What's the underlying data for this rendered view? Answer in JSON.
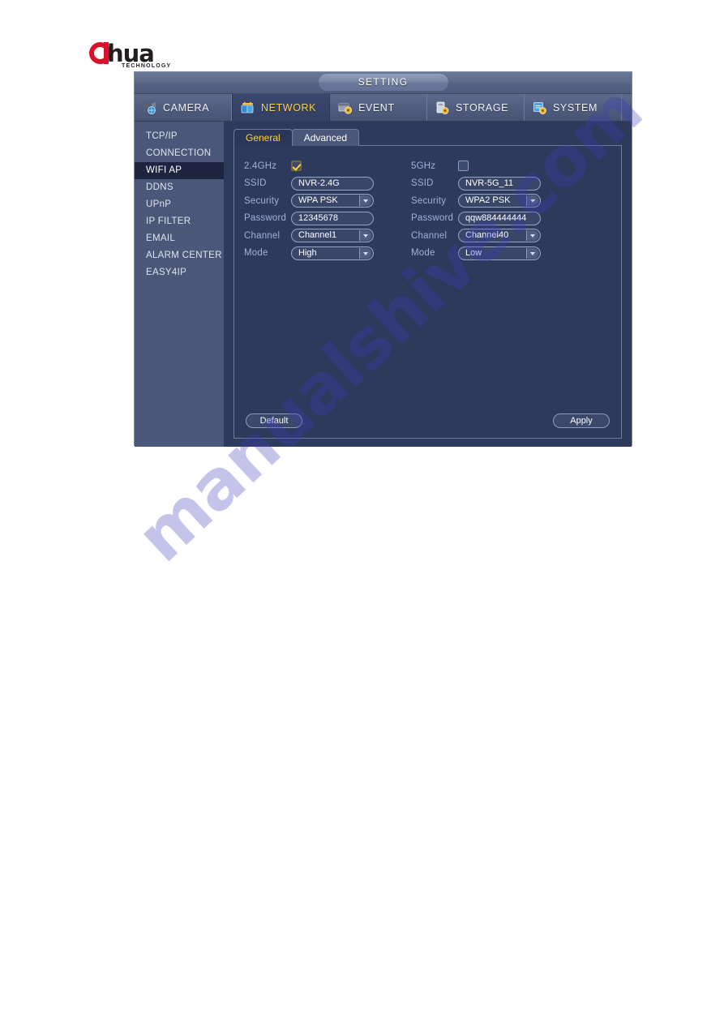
{
  "brand": {
    "name": "alhua",
    "wordmark": "hua",
    "tagline": "TECHNOLOGY"
  },
  "window": {
    "title": "SETTING"
  },
  "topnav": [
    {
      "label": "CAMERA",
      "icon": "camera-icon",
      "active": false
    },
    {
      "label": "NETWORK",
      "icon": "network-icon",
      "active": true
    },
    {
      "label": "EVENT",
      "icon": "event-icon",
      "active": false
    },
    {
      "label": "STORAGE",
      "icon": "storage-icon",
      "active": false
    },
    {
      "label": "SYSTEM",
      "icon": "system-icon",
      "active": false
    }
  ],
  "sidebar": {
    "items": [
      {
        "label": "TCP/IP",
        "active": false
      },
      {
        "label": "CONNECTION",
        "active": false
      },
      {
        "label": "WIFI AP",
        "active": true
      },
      {
        "label": "DDNS",
        "active": false
      },
      {
        "label": "UPnP",
        "active": false
      },
      {
        "label": "IP FILTER",
        "active": false
      },
      {
        "label": "EMAIL",
        "active": false
      },
      {
        "label": "ALARM CENTER",
        "active": false
      },
      {
        "label": "EASY4IP",
        "active": false
      }
    ]
  },
  "tabs": [
    {
      "label": "General",
      "active": true
    },
    {
      "label": "Advanced",
      "active": false
    }
  ],
  "form": {
    "band_24": {
      "enable_label": "2.4GHz",
      "enabled": true,
      "ssid_label": "SSID",
      "ssid_value": "NVR-2.4G",
      "security_label": "Security",
      "security_value": "WPA PSK",
      "password_label": "Password",
      "password_value": "12345678",
      "channel_label": "Channel",
      "channel_value": "Channel1",
      "mode_label": "Mode",
      "mode_value": "High"
    },
    "band_5": {
      "enable_label": "5GHz",
      "enabled": false,
      "ssid_label": "SSID",
      "ssid_value": "NVR-5G_11",
      "security_label": "Security",
      "security_value": "WPA2 PSK",
      "password_label": "Password",
      "password_value": "qqw884444444",
      "channel_label": "Channel",
      "channel_value": "Channel40",
      "mode_label": "Mode",
      "mode_value": "Low"
    }
  },
  "buttons": {
    "default_label": "Default",
    "apply_label": "Apply"
  },
  "watermark": {
    "text": "manualshive.com"
  },
  "colors": {
    "window_bg": "#2e3a5c",
    "sidebar_bg": "#4a5778",
    "sidebar_active_bg": "#1d2440",
    "accent_yellow": "#ffd24a",
    "label_blue": "#9fb0d8",
    "brand_red": "#d6132a"
  }
}
